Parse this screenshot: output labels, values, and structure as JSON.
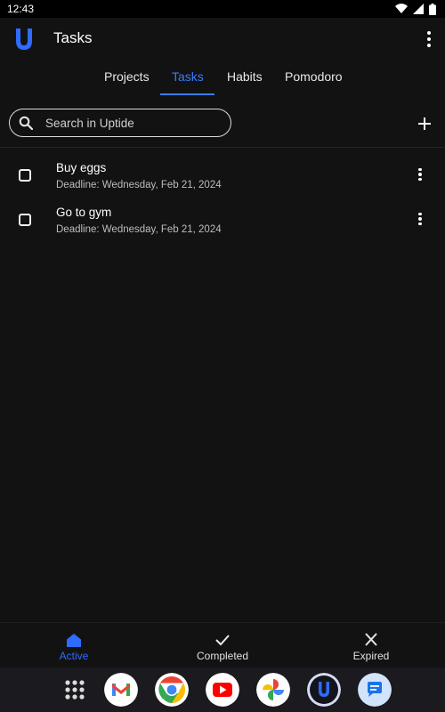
{
  "status_bar": {
    "time": "12:43"
  },
  "app_bar": {
    "title": "Tasks"
  },
  "tabs": [
    {
      "label": "Projects",
      "active": false
    },
    {
      "label": "Tasks",
      "active": true
    },
    {
      "label": "Habits",
      "active": false
    },
    {
      "label": "Pomodoro",
      "active": false
    }
  ],
  "search": {
    "placeholder": "Search in Uptide"
  },
  "tasks": [
    {
      "title": "Buy eggs",
      "deadline": "Deadline: Wednesday, Feb 21, 2024",
      "checked": false
    },
    {
      "title": "Go to gym",
      "deadline": "Deadline: Wednesday, Feb 21, 2024",
      "checked": false
    }
  ],
  "bottom_nav": [
    {
      "label": "Active",
      "icon": "home-icon",
      "active": true
    },
    {
      "label": "Completed",
      "icon": "check-icon",
      "active": false
    },
    {
      "label": "Expired",
      "icon": "close-icon",
      "active": false
    }
  ],
  "dock": [
    {
      "icon": "app-drawer-icon"
    },
    {
      "icon": "gmail-icon"
    },
    {
      "icon": "chrome-icon"
    },
    {
      "icon": "youtube-icon"
    },
    {
      "icon": "photos-icon"
    },
    {
      "icon": "uptide-icon"
    },
    {
      "icon": "messages-icon"
    }
  ],
  "colors": {
    "accent": "#3d7bff",
    "background": "#121213"
  }
}
